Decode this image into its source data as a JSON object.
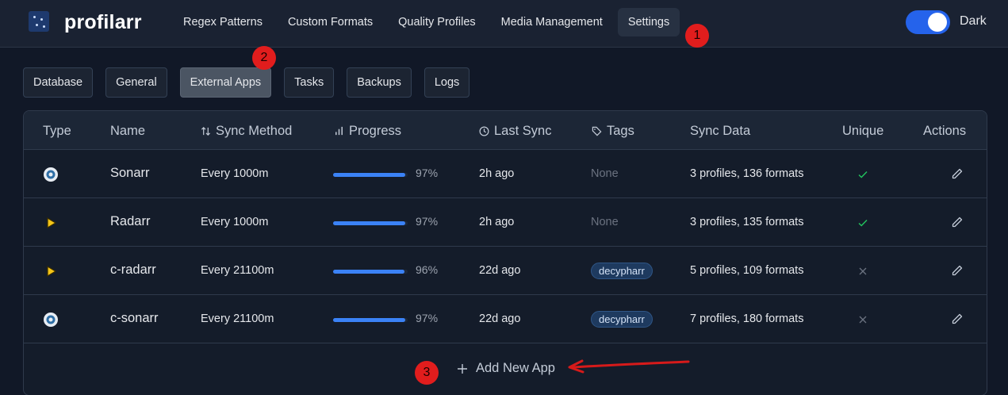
{
  "app": {
    "title": "profilarr"
  },
  "nav": {
    "items": [
      {
        "label": "Regex Patterns"
      },
      {
        "label": "Custom Formats"
      },
      {
        "label": "Quality Profiles"
      },
      {
        "label": "Media Management"
      },
      {
        "label": "Settings",
        "active": true
      }
    ]
  },
  "theme": {
    "label": "Dark",
    "enabled": true
  },
  "tabs": [
    {
      "label": "Database"
    },
    {
      "label": "General"
    },
    {
      "label": "External Apps",
      "active": true
    },
    {
      "label": "Tasks"
    },
    {
      "label": "Backups"
    },
    {
      "label": "Logs"
    }
  ],
  "table": {
    "headers": {
      "type": "Type",
      "name": "Name",
      "sync_method": "Sync Method",
      "progress": "Progress",
      "last_sync": "Last Sync",
      "tags": "Tags",
      "sync_data": "Sync Data",
      "unique": "Unique",
      "actions": "Actions"
    },
    "rows": [
      {
        "type": "sonarr",
        "name": "Sonarr",
        "sync_method": "Every 1000m",
        "progress": 97,
        "progress_label": "97%",
        "last_sync": "2h ago",
        "tag": "None",
        "sync_data": "3 profiles, 136 formats",
        "unique": true
      },
      {
        "type": "radarr",
        "name": "Radarr",
        "sync_method": "Every 1000m",
        "progress": 97,
        "progress_label": "97%",
        "last_sync": "2h ago",
        "tag": "None",
        "sync_data": "3 profiles, 135 formats",
        "unique": true
      },
      {
        "type": "radarr",
        "name": "c-radarr",
        "sync_method": "Every 21100m",
        "progress": 96,
        "progress_label": "96%",
        "last_sync": "22d ago",
        "tag": "decypharr",
        "sync_data": "5 profiles, 109 formats",
        "unique": false
      },
      {
        "type": "sonarr",
        "name": "c-sonarr",
        "sync_method": "Every 21100m",
        "progress": 97,
        "progress_label": "97%",
        "last_sync": "22d ago",
        "tag": "decypharr",
        "sync_data": "7 profiles, 180 formats",
        "unique": false
      }
    ],
    "add_label": "Add New App"
  },
  "annotations": {
    "one": "1",
    "two": "2",
    "three": "3"
  },
  "colors": {
    "accent": "#3b82f6",
    "check": "#22c55e",
    "cross": "#6b7280",
    "annotation": "#e11d1d"
  }
}
